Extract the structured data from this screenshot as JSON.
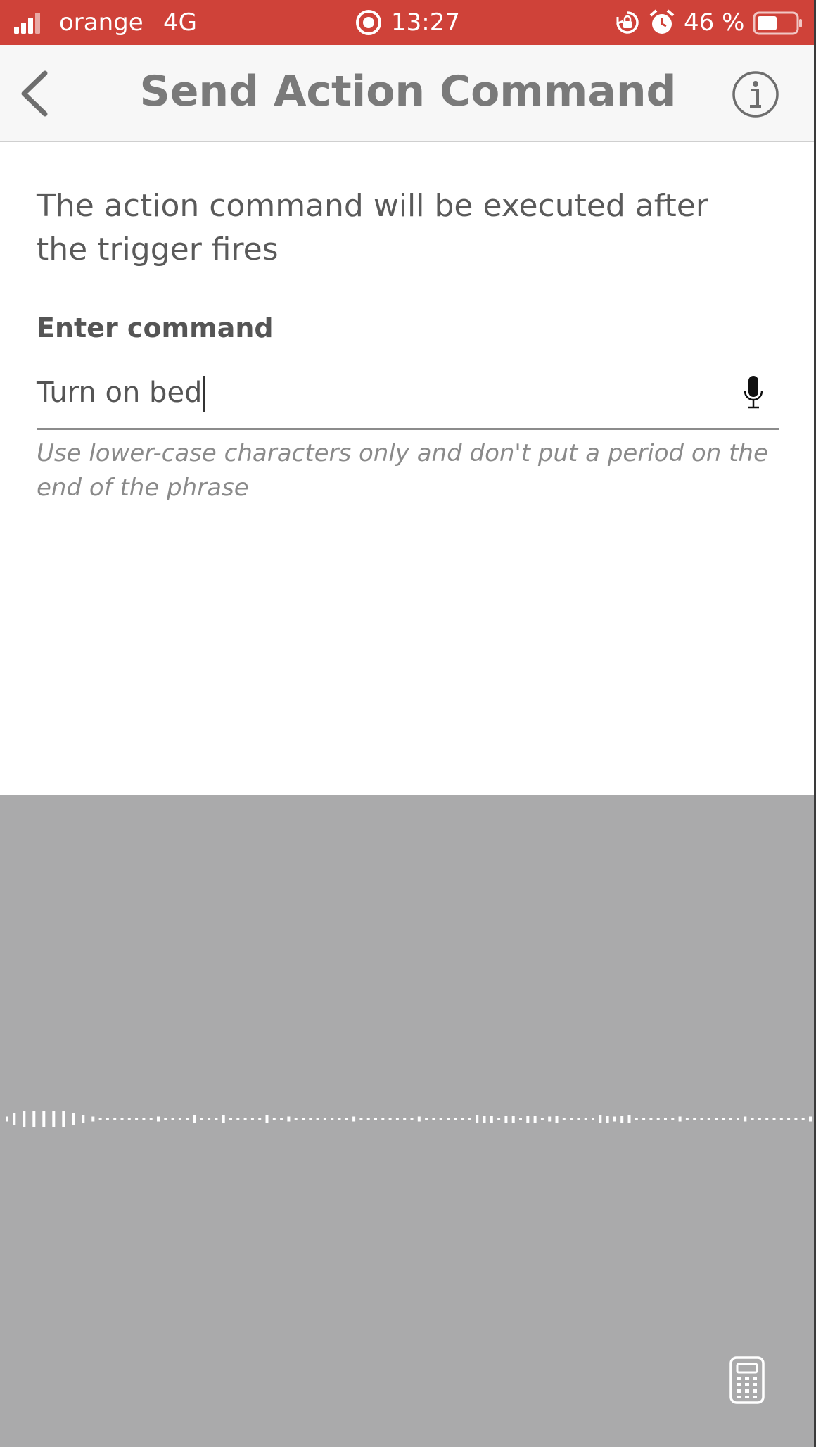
{
  "status_bar": {
    "carrier": "orange",
    "network": "4G",
    "time": "13:27",
    "battery": "46 %",
    "icons": [
      "signal-icon",
      "recording-icon",
      "orientation-lock-icon",
      "alarm-icon",
      "battery-icon"
    ],
    "background_color": "#cf4239"
  },
  "nav": {
    "title": "Send Action Command",
    "back_icon": "chevron-left-icon",
    "info_icon": "info-icon"
  },
  "content": {
    "description": "The action command will be executed after the trigger fires",
    "field_label": "Enter command",
    "field_value": "Turn on bed",
    "mic_icon": "microphone-icon",
    "hint": "Use lower-case characters only and don't put a period on the end of the phrase"
  },
  "dictation": {
    "waveform_icon": "waveform-icon",
    "keyboard_icon": "calculator-keyboard-icon",
    "background_color": "#aaaaab"
  }
}
